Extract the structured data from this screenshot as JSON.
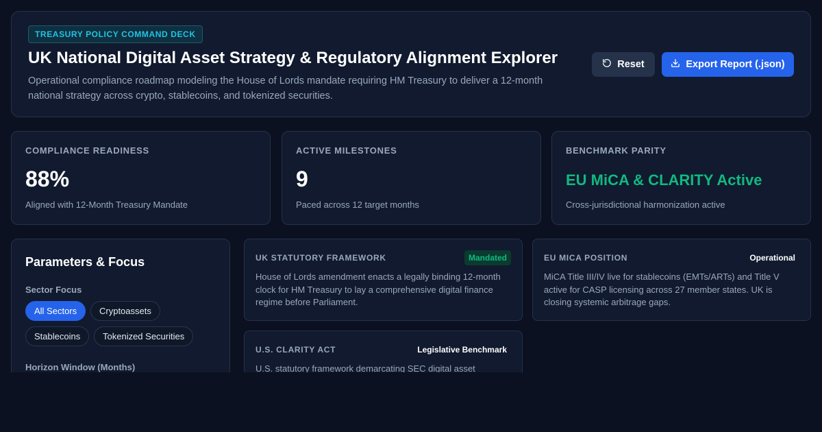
{
  "header": {
    "kicker": "TREASURY POLICY COMMAND DECK",
    "title": "UK National Digital Asset Strategy & Regulatory Alignment Explorer",
    "subtitle": "Operational compliance roadmap modeling the House of Lords mandate requiring HM Treasury to deliver a 12-month national strategy across crypto, stablecoins, and tokenized securities.",
    "reset_label": "Reset",
    "export_label": "Export Report (.json)",
    "reset_icon": "rotate-ccw-icon",
    "export_icon": "download-icon"
  },
  "stats": [
    {
      "label": "COMPLIANCE READINESS",
      "value": "88%",
      "note": "Aligned with 12-Month Treasury Mandate"
    },
    {
      "label": "ACTIVE MILESTONES",
      "value": "9",
      "note": "Paced across 12 target months"
    },
    {
      "label": "BENCHMARK PARITY",
      "value": "EU MiCA & CLARITY Active",
      "note": "Cross-jurisdictional harmonization active",
      "value_color": "#10b981"
    }
  ],
  "params": {
    "title": "Parameters & Focus",
    "sector_label": "Sector Focus",
    "sectors": [
      "All Sectors",
      "Cryptoassets",
      "Stablecoins",
      "Tokenized Securities"
    ],
    "active_sector": "All Sectors",
    "horizon_label": "Horizon Window (Months)"
  },
  "frameworks": [
    {
      "name": "UK STATUTORY FRAMEWORK",
      "badge": "Mandated",
      "desc": "House of Lords amendment enacts a legally binding 12-month clock for HM Treasury to lay a comprehensive digital finance regime before Parliament."
    },
    {
      "name": "EU MICA POSITION",
      "badge": "Operational",
      "desc": "MiCA Title III/IV live for stablecoins (EMTs/ARTs) and Title V active for CASP licensing across 27 member states. UK is closing systemic arbitrage gaps."
    },
    {
      "name": "U.S. CLARITY ACT",
      "badge": "Legislative Benchmark",
      "desc": "U.S. statutory framework demarcating SEC digital asset"
    }
  ],
  "colors": {
    "background": "#0b1120",
    "card": "#111a2e",
    "accent_blue": "#2563eb",
    "accent_green": "#10b981",
    "accent_cyan": "#22c3e6"
  }
}
